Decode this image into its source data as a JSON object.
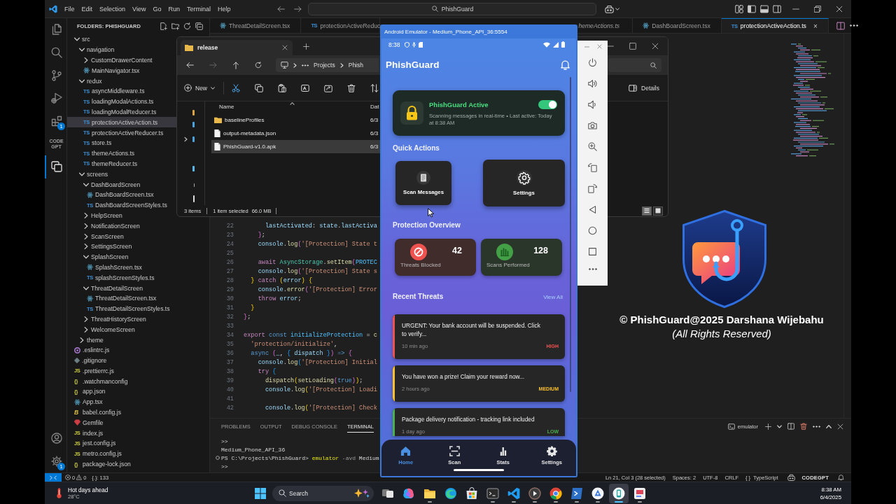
{
  "titlebar": {
    "menu": [
      "File",
      "Edit",
      "Selection",
      "View",
      "Go",
      "Run",
      "Terminal",
      "Help"
    ],
    "command_center": "PhishGuard"
  },
  "activity_bar": {
    "top": [
      {
        "selected": false
      },
      {
        "selected": false
      },
      {
        "selected": false
      },
      {
        "selected": false
      },
      {
        "selected": false,
        "badge": "1"
      },
      {
        "selected": false,
        "label": "CODE GPT"
      },
      {
        "selected": true
      }
    ],
    "bottom": [
      {
        "selected": false
      },
      {
        "selected": false,
        "badge": "1"
      }
    ]
  },
  "sidebar": {
    "title": "FOLDERS: PHISHGUARD",
    "tree": [
      {
        "label": "src",
        "kind": "folder",
        "expanded": true,
        "selected": false,
        "children": [
          {
            "label": "navigation",
            "kind": "folder",
            "expanded": true,
            "selected": false,
            "children": [
              {
                "label": "CustomDrawerContent",
                "kind": "folder",
                "expanded": false,
                "selected": false
              },
              {
                "label": "MainNavigator.tsx",
                "kind": "react",
                "selected": false
              }
            ]
          },
          {
            "label": "redux",
            "kind": "folder",
            "expanded": true,
            "selected": false,
            "children": [
              {
                "label": "asyncMiddleware.ts",
                "kind": "ts",
                "icon": "TS",
                "selected": false
              },
              {
                "label": "loadingModalActions.ts",
                "kind": "ts",
                "icon": "TS",
                "selected": false
              },
              {
                "label": "loadingModalReducer.ts",
                "kind": "ts",
                "icon": "TS",
                "selected": false
              },
              {
                "label": "protectionActiveAction.ts",
                "kind": "ts",
                "icon": "TS",
                "selected": true
              },
              {
                "label": "protectionActiveReducer.ts",
                "kind": "ts",
                "icon": "TS",
                "selected": false
              },
              {
                "label": "store.ts",
                "kind": "ts",
                "icon": "TS",
                "selected": false
              },
              {
                "label": "themeActions.ts",
                "kind": "ts",
                "icon": "TS",
                "selected": false
              },
              {
                "label": "themeReducer.ts",
                "kind": "ts",
                "icon": "TS",
                "selected": false
              }
            ]
          },
          {
            "label": "screens",
            "kind": "folder",
            "expanded": true,
            "selected": false,
            "children": [
              {
                "label": "DashBoardScreen",
                "kind": "folder",
                "expanded": true,
                "selected": false,
                "children": [
                  {
                    "label": "DashBoardScreen.tsx",
                    "kind": "react",
                    "selected": false
                  },
                  {
                    "label": "DashBoardScreenStyles.ts",
                    "kind": "ts",
                    "icon": "TS",
                    "selected": false
                  }
                ]
              },
              {
                "label": "HelpScreen",
                "kind": "folder",
                "expanded": false,
                "selected": false
              },
              {
                "label": "NotificationScreen",
                "kind": "folder",
                "expanded": false,
                "selected": false
              },
              {
                "label": "ScanScreen",
                "kind": "folder",
                "expanded": false,
                "selected": false
              },
              {
                "label": "SettingsScreen",
                "kind": "folder",
                "expanded": false,
                "selected": false
              },
              {
                "label": "SplashScreen",
                "kind": "folder",
                "expanded": true,
                "selected": false,
                "children": [
                  {
                    "label": "SplashScreen.tsx",
                    "kind": "react",
                    "selected": false
                  },
                  {
                    "label": "splashScreenStyles.ts",
                    "kind": "ts",
                    "icon": "TS",
                    "selected": false
                  }
                ]
              },
              {
                "label": "ThreatDetailScreen",
                "kind": "folder",
                "expanded": true,
                "selected": false,
                "children": [
                  {
                    "label": "ThreatDetailScreen.tsx",
                    "kind": "react",
                    "selected": false
                  },
                  {
                    "label": "ThreatDetailScreenStyles.ts",
                    "kind": "ts",
                    "icon": "TS",
                    "selected": false
                  }
                ]
              },
              {
                "label": "ThreatHistoryScreen",
                "kind": "folder",
                "expanded": false,
                "selected": false
              },
              {
                "label": "WelcomeScreen",
                "kind": "folder",
                "expanded": false,
                "selected": false
              }
            ]
          },
          {
            "label": "theme",
            "kind": "folder",
            "expanded": false,
            "selected": false
          }
        ]
      },
      {
        "label": ".eslintrc.js",
        "kind": "eslint",
        "selected": false
      },
      {
        "label": ".gitignore",
        "kind": "git",
        "selected": false
      },
      {
        "label": ".prettierrc.js",
        "kind": "js",
        "icon": "JS",
        "selected": false
      },
      {
        "label": ".watchmanconfig",
        "kind": "json",
        "icon": "{}",
        "selected": false
      },
      {
        "label": "app.json",
        "kind": "json",
        "icon": "{}",
        "selected": false
      },
      {
        "label": "App.tsx",
        "kind": "react",
        "selected": false
      },
      {
        "label": "babel.config.js",
        "kind": "babel",
        "icon": "B",
        "selected": false
      },
      {
        "label": "Gemfile",
        "kind": "ruby",
        "selected": false
      },
      {
        "label": "index.js",
        "kind": "js",
        "icon": "JS",
        "selected": false
      },
      {
        "label": "jest.config.js",
        "kind": "js",
        "icon": "JS",
        "selected": false
      },
      {
        "label": "metro.config.js",
        "kind": "js",
        "icon": "JS",
        "selected": false
      },
      {
        "label": "package-lock.json",
        "kind": "json",
        "icon": "{}",
        "selected": false
      }
    ]
  },
  "editor": {
    "tabs": [
      {
        "label": "ThreatDetailScreen.tsx",
        "kind": "react",
        "selected": false,
        "preview": false
      },
      {
        "label": "protectionActiveReduc",
        "kind": "ts",
        "icon": "TS",
        "selected": false,
        "preview": false
      },
      {
        "label": "hemeActions.ts",
        "selected": false,
        "preview": true
      },
      {
        "label": "DashBoardScreen.tsx",
        "kind": "react",
        "selected": false,
        "preview": false
      },
      {
        "label": "protectionActiveAction.ts",
        "kind": "ts",
        "icon": "TS",
        "selected": true,
        "preview": false,
        "close": "×"
      }
    ],
    "lines": [
      {
        "number": "22",
        "tokens": [
          {
            "kind": "variable",
            "text": "      lastActivated"
          },
          {
            "kind": "plain",
            "text": ": "
          },
          {
            "kind": "variable",
            "text": "state"
          },
          {
            "kind": "plain",
            "text": "."
          },
          {
            "kind": "variable",
            "text": "lastActiva"
          }
        ]
      },
      {
        "number": "23",
        "tokens": [
          {
            "kind": "bracket2",
            "text": "    }"
          },
          {
            "kind": "plain",
            "text": ";"
          }
        ]
      },
      {
        "number": "24",
        "tokens": [
          {
            "kind": "variable",
            "text": "    console"
          },
          {
            "kind": "plain",
            "text": "."
          },
          {
            "kind": "function",
            "text": "log"
          },
          {
            "kind": "bracket2",
            "text": "("
          },
          {
            "kind": "string",
            "text": "'[Protection] State t"
          }
        ]
      },
      {
        "number": "25"
      },
      {
        "number": "26",
        "tokens": [
          {
            "kind": "control",
            "text": "    await "
          },
          {
            "kind": "class",
            "text": "AsyncStorage"
          },
          {
            "kind": "plain",
            "text": "."
          },
          {
            "kind": "function",
            "text": "setItem"
          },
          {
            "kind": "bracket2",
            "text": "("
          },
          {
            "kind": "constant",
            "text": "PROTEC"
          }
        ]
      },
      {
        "number": "27",
        "tokens": [
          {
            "kind": "variable",
            "text": "    console"
          },
          {
            "kind": "plain",
            "text": "."
          },
          {
            "kind": "function",
            "text": "log"
          },
          {
            "kind": "bracket2",
            "text": "("
          },
          {
            "kind": "string",
            "text": "'[Protection] State s"
          }
        ]
      },
      {
        "number": "28",
        "tokens": [
          {
            "kind": "bracket1",
            "text": "  } "
          },
          {
            "kind": "control",
            "text": "catch "
          },
          {
            "kind": "bracket1",
            "text": "("
          },
          {
            "kind": "variable",
            "text": "error"
          },
          {
            "kind": "bracket1",
            "text": ") {"
          }
        ]
      },
      {
        "number": "29",
        "tokens": [
          {
            "kind": "variable",
            "text": "    console"
          },
          {
            "kind": "plain",
            "text": "."
          },
          {
            "kind": "function",
            "text": "error"
          },
          {
            "kind": "bracket2",
            "text": "("
          },
          {
            "kind": "string",
            "text": "'[Protection] Error"
          }
        ]
      },
      {
        "number": "30",
        "tokens": [
          {
            "kind": "control",
            "text": "    throw "
          },
          {
            "kind": "variable",
            "text": "error"
          },
          {
            "kind": "plain",
            "text": ";"
          }
        ]
      },
      {
        "number": "31",
        "tokens": [
          {
            "kind": "bracket1",
            "text": "  }"
          }
        ]
      },
      {
        "number": "32",
        "tokens": [
          {
            "kind": "bracket2",
            "text": "}"
          },
          {
            "kind": "plain",
            "text": ";"
          }
        ]
      },
      {
        "number": "33"
      },
      {
        "number": "34",
        "tokens": [
          {
            "kind": "control",
            "text": "export "
          },
          {
            "kind": "keyword",
            "text": "const "
          },
          {
            "kind": "constant",
            "text": "initializeProtection"
          },
          {
            "kind": "plain",
            "text": " = "
          },
          {
            "kind": "function",
            "text": "c"
          }
        ]
      },
      {
        "number": "35",
        "tokens": [
          {
            "kind": "string",
            "text": "  'protection/initialize'"
          },
          {
            "kind": "plain",
            "text": ","
          }
        ]
      },
      {
        "number": "36",
        "tokens": [
          {
            "kind": "keyword",
            "text": "  async "
          },
          {
            "kind": "bracket2",
            "text": "("
          },
          {
            "kind": "variable",
            "text": "_"
          },
          {
            "kind": "plain",
            "text": ", "
          },
          {
            "kind": "bracket3",
            "text": "{ "
          },
          {
            "kind": "variable",
            "text": "dispatch "
          },
          {
            "kind": "bracket3",
            "text": "}"
          },
          {
            "kind": "bracket2",
            "text": ")"
          },
          {
            "kind": "keyword",
            "text": " => "
          },
          {
            "kind": "bracket2",
            "text": "{"
          }
        ]
      },
      {
        "number": "37",
        "tokens": [
          {
            "kind": "variable",
            "text": "    console"
          },
          {
            "kind": "plain",
            "text": "."
          },
          {
            "kind": "function",
            "text": "log"
          },
          {
            "kind": "bracket3",
            "text": "("
          },
          {
            "kind": "string",
            "text": "'[Protection] Initial"
          }
        ]
      },
      {
        "number": "38",
        "tokens": [
          {
            "kind": "control",
            "text": "    try "
          },
          {
            "kind": "bracket3",
            "text": "{"
          }
        ]
      },
      {
        "number": "39",
        "tokens": [
          {
            "kind": "function",
            "text": "      dispatch"
          },
          {
            "kind": "bracket1",
            "text": "("
          },
          {
            "kind": "function",
            "text": "setLoading"
          },
          {
            "kind": "bracket2",
            "text": "("
          },
          {
            "kind": "keyword",
            "text": "true"
          },
          {
            "kind": "bracket2",
            "text": ")"
          },
          {
            "kind": "bracket1",
            "text": ")"
          },
          {
            "kind": "plain",
            "text": ";"
          }
        ]
      },
      {
        "number": "40",
        "tokens": [
          {
            "kind": "variable",
            "text": "      console"
          },
          {
            "kind": "plain",
            "text": "."
          },
          {
            "kind": "function",
            "text": "log"
          },
          {
            "kind": "bracket1",
            "text": "("
          },
          {
            "kind": "string",
            "text": "'[Protection] Loadi"
          }
        ]
      },
      {
        "number": "41"
      },
      {
        "number": "42",
        "tokens": [
          {
            "kind": "variable",
            "text": "      console"
          },
          {
            "kind": "plain",
            "text": "."
          },
          {
            "kind": "function",
            "text": "log"
          },
          {
            "kind": "bracket1",
            "text": "("
          },
          {
            "kind": "string",
            "text": "'[Protection] Check"
          }
        ]
      }
    ]
  },
  "panel": {
    "tabs": [
      {
        "label": "PROBLEMS",
        "selected": false
      },
      {
        "label": "OUTPUT",
        "selected": false
      },
      {
        "label": "DEBUG CONSOLE",
        "selected": false
      },
      {
        "label": "TERMINAL",
        "selected": true
      }
    ],
    "terminal": "emulator",
    "lines": [
      {
        "marker": false,
        "tokens": [
          {
            "kind": "plain",
            "text": ">>"
          }
        ]
      },
      {
        "marker": false,
        "tokens": [
          {
            "kind": "plain",
            "text": "Medium_Phone_API_36"
          }
        ]
      },
      {
        "marker": true,
        "tokens": [
          {
            "kind": "plain",
            "text": "PS C:\\Projects\\PhishGuard> "
          },
          {
            "kind": "command",
            "text": "emulator"
          },
          {
            "kind": "flag",
            "text": " -avd "
          },
          {
            "kind": "plain",
            "text": "Medium"
          }
        ]
      },
      {
        "marker": false,
        "tokens": [
          {
            "kind": "plain",
            "text": ">>"
          }
        ]
      }
    ]
  },
  "status_bar": {
    "errors": "0",
    "warnings": "0",
    "info": "{.}: 133",
    "items": [
      "Ln 21, Col 3 (28 selected)",
      "Spaces: 2",
      "UTF-8",
      "CRLF"
    ],
    "language": {
      "icon": "{ }",
      "label": "TypeScript"
    },
    "brand": "CODEGPT"
  },
  "file_explorer": {
    "tab": "release",
    "path": [
      "Projects",
      "Phish"
    ],
    "new": "New",
    "details": "Details",
    "columns": [
      "Name",
      "Dat"
    ],
    "rows": [
      {
        "kind": "folder",
        "name": "baselineProfiles",
        "date": "6/3",
        "selected": false
      },
      {
        "kind": "file",
        "name": "output-metadata.json",
        "date": "6/3",
        "selected": false
      },
      {
        "kind": "file",
        "name": "PhishGuard-v1.0.apk",
        "date": "6/3",
        "selected": true
      }
    ],
    "status": [
      "3 items",
      "1 item selected",
      "66.0 MB"
    ],
    "views": [
      {
        "selected": true
      },
      {
        "selected": false
      }
    ]
  },
  "emulator": {
    "title": "Android Emulator - Medium_Phone_API_36:5554",
    "phone": {
      "time": "8:38",
      "app_title": "PhishGuard",
      "protection": {
        "title": "PhishGuard Active",
        "on": true,
        "text": "Scanning messages in real-time • Last active: Today at 8:38 AM"
      },
      "quick_actions": {
        "heading": "Quick Actions",
        "items": [
          "Scan Messages",
          "Settings"
        ]
      },
      "overview": {
        "heading": "Protection Overview",
        "stats": [
          {
            "value": "42",
            "label": "Threats Blocked",
            "color": "#ef5350"
          },
          {
            "value": "128",
            "label": "Scans Performed",
            "color": "#43a047"
          }
        ]
      },
      "recent": {
        "heading": "Recent Threats",
        "link": "View All",
        "items": [
          {
            "title": "URGENT: Your bank account will be suspended. Click to verify...",
            "time": "10 min ago",
            "severity": "HIGH",
            "color": "#ef5350"
          },
          {
            "title": "You have won a prize! Claim your reward now...",
            "time": "2 hours ago",
            "severity": "MEDIUM",
            "color": "#fbc02d"
          },
          {
            "title": "Package delivery notification - tracking link included",
            "time": "1 day ago",
            "severity": "LOW",
            "color": "#4caf50"
          }
        ]
      },
      "nav": [
        {
          "label": "Home",
          "selected": true
        },
        {
          "label": "Scan",
          "selected": false
        },
        {
          "label": "Stats",
          "selected": false
        },
        {
          "label": "Settings",
          "selected": false
        }
      ]
    }
  },
  "overlay": {
    "copyright": "© PhishGuard@2025 Darshana Wijebahu",
    "rights": "(All Rights Reserved)"
  },
  "taskbar": {
    "weather": {
      "title": "Hot days ahead",
      "temperature": "28°C"
    },
    "search": {
      "placeholder": "Search"
    },
    "apps": [
      {
        "selected": false,
        "running": false
      },
      {
        "selected": false,
        "running": false
      },
      {
        "selected": false,
        "running": true
      },
      {
        "selected": false,
        "running": false
      },
      {
        "selected": false,
        "running": false
      },
      {
        "selected": false,
        "running": true
      },
      {
        "selected": false,
        "running": true
      },
      {
        "selected": false,
        "running": true
      },
      {
        "selected": false,
        "running": true
      },
      {
        "selected": false,
        "running": true
      },
      {
        "selected": false,
        "running": true
      },
      {
        "selected": true,
        "running": true
      },
      {
        "selected": false,
        "running": true
      }
    ],
    "time": "8:38 AM",
    "date": "6/4/2025"
  }
}
